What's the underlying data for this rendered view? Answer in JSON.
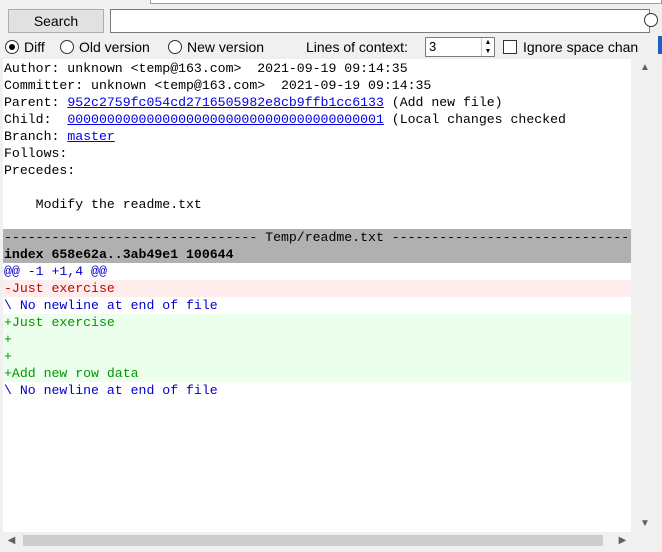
{
  "toolbar": {
    "search_label": "Search",
    "search_value": ""
  },
  "options": {
    "diff_label": "Diff",
    "old_label": "Old version",
    "new_label": "New version",
    "context_label": "Lines of context:",
    "context_value": "3",
    "ignore_label": "Ignore space chan",
    "selected": "Diff"
  },
  "commit": {
    "author": "Author: unknown <temp@163.com>  2021-09-19 09:14:35",
    "committer": "Committer: unknown <temp@163.com>  2021-09-19 09:14:35",
    "parent_label": "Parent: ",
    "parent_hash": "952c2759fc054cd2716505982e8cb9ffb1cc6133",
    "parent_note": " (Add new file)",
    "child_label": "Child:  ",
    "child_hash": "0000000000000000000000000000000000000001",
    "child_note": " (Local changes checked",
    "branch_label": "Branch: ",
    "branch_name": "master",
    "follows": "Follows:",
    "precedes": "Precedes:",
    "message": "    Modify the readme.txt"
  },
  "diff": {
    "file_header": "-------------------------------- Temp/readme.txt --------------------------------",
    "index_line": "index 658e62a..3ab49e1 100644",
    "hunk": "@@ -1 +1,4 @@",
    "lines": [
      {
        "type": "del",
        "text": "-Just exercise"
      },
      {
        "type": "nonl",
        "text": "\\ No newline at end of file"
      },
      {
        "type": "add",
        "text": "+Just exercise"
      },
      {
        "type": "add",
        "text": "+"
      },
      {
        "type": "add",
        "text": "+"
      },
      {
        "type": "add",
        "text": "+Add new row data"
      },
      {
        "type": "nonl",
        "text": "\\ No newline at end of file"
      }
    ]
  },
  "scroll": {
    "up_icon": "▲",
    "down_icon": "▼",
    "left_icon": "◀",
    "right_icon": "▶"
  }
}
